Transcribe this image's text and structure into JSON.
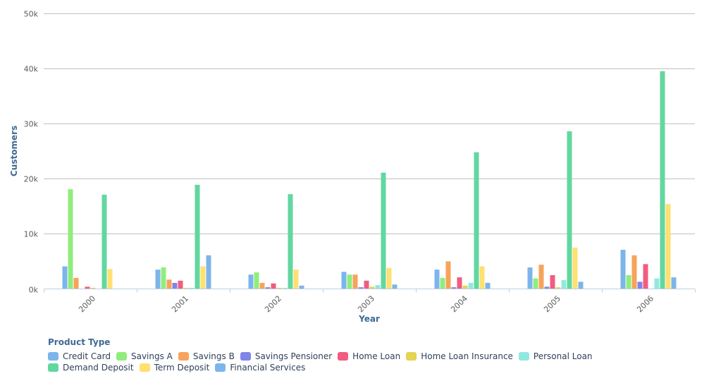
{
  "chart_data": {
    "type": "bar",
    "title": "",
    "xlabel": "Year",
    "ylabel": "Customers",
    "ylim": [
      0,
      50000
    ],
    "yticks": [
      0,
      10000,
      20000,
      30000,
      40000,
      50000
    ],
    "ytick_labels": [
      "0k",
      "10k",
      "20k",
      "30k",
      "40k",
      "50k"
    ],
    "grid": true,
    "legend_title": "Product Type",
    "legend_position": "bottom-left",
    "categories": [
      "2000",
      "2001",
      "2002",
      "2003",
      "2004",
      "2005",
      "2006"
    ],
    "series": [
      {
        "name": "Credit Card",
        "color": "#7cb5ec",
        "values": [
          4100,
          3500,
          2600,
          3100,
          3500,
          3900,
          7100
        ]
      },
      {
        "name": "Savings A",
        "color": "#90ed7d",
        "values": [
          18100,
          3900,
          3000,
          2600,
          2000,
          1900,
          2500
        ]
      },
      {
        "name": "Savings B",
        "color": "#f7a35c",
        "values": [
          2000,
          1700,
          1100,
          2600,
          5000,
          4400,
          6100
        ]
      },
      {
        "name": "Savings Pensioner",
        "color": "#8085e9",
        "values": [
          0,
          1100,
          300,
          300,
          300,
          400,
          1300
        ]
      },
      {
        "name": "Home Loan",
        "color": "#f15c80",
        "values": [
          400,
          1500,
          1000,
          1500,
          2100,
          2500,
          4500
        ]
      },
      {
        "name": "Home Loan Insurance",
        "color": "#e4d354",
        "values": [
          200,
          200,
          200,
          400,
          600,
          300,
          0
        ]
      },
      {
        "name": "Personal Loan",
        "color": "#91e8e1",
        "values": [
          0,
          200,
          200,
          700,
          1100,
          1600,
          1900
        ]
      },
      {
        "name": "Demand Deposit",
        "color": "#62d79f",
        "values": [
          17100,
          18900,
          17200,
          21100,
          24800,
          28600,
          39500
        ]
      },
      {
        "name": "Term Deposit",
        "color": "#ffe070",
        "values": [
          3600,
          4100,
          3500,
          3800,
          4100,
          7500,
          15400
        ]
      },
      {
        "name": "Financial Services",
        "color": "#7cb5ec",
        "values": [
          0,
          6100,
          600,
          800,
          1100,
          1300,
          2100
        ]
      }
    ]
  }
}
